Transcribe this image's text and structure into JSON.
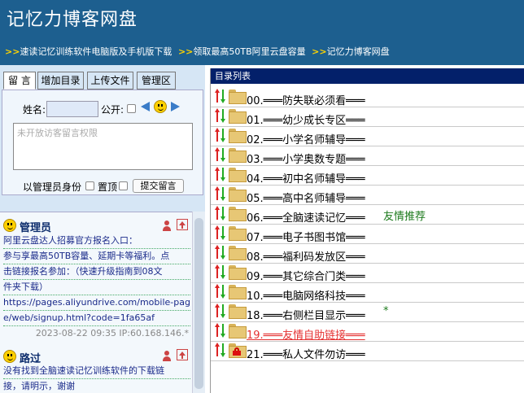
{
  "header": {
    "title": "记忆力博客网盘",
    "nav": [
      {
        "label": "速读记忆训练软件电脑版及手机版下载"
      },
      {
        "label": "领取最高50TB阿里云盘容量"
      },
      {
        "label": "记忆力博客网盘"
      }
    ]
  },
  "left": {
    "tabs": [
      "留 言",
      "增加目录",
      "上传文件",
      "管理区"
    ],
    "form": {
      "name_label": "姓名:",
      "public_label": "公开:",
      "textarea_placeholder": "未开放访客留言权限",
      "admin_label": "以管理员身份",
      "pin_label": "置顶",
      "submit_label": "提交留言"
    },
    "posts": [
      {
        "author": "管理员",
        "lines": [
          "阿里云盘达人招募官方报名入口：",
          "参与享最高50TB容量、延期卡等福利。点",
          "击链接报名参加：（快速升级指南到08文",
          "件夹下载）",
          "https://pages.aliyundrive.com/mobile-pag",
          "e/web/signup.html?code=1fa65af"
        ],
        "meta": "2023-08-22 09:35 IP:60.168.146.*"
      },
      {
        "author": "路过",
        "lines": [
          "没有找到全脑速读记忆训练软件的下载链",
          "接，请明示，谢谢"
        ],
        "meta": ""
      }
    ]
  },
  "right": {
    "header": "目录列表",
    "rows": [
      {
        "name": "00.═══防失联必须看═══",
        "extra": "",
        "special": false,
        "locked": false
      },
      {
        "name": "01.═══幼少成长专区═══",
        "extra": "",
        "special": false,
        "locked": false
      },
      {
        "name": "02.═══小学名师辅导═══",
        "extra": "",
        "special": false,
        "locked": false
      },
      {
        "name": "03.═══小学奥数专题═══",
        "extra": "",
        "special": false,
        "locked": false
      },
      {
        "name": "04.═══初中名师辅导═══",
        "extra": "",
        "special": false,
        "locked": false
      },
      {
        "name": "05.═══高中名师辅导═══",
        "extra": "",
        "special": false,
        "locked": false
      },
      {
        "name": "06.═══全脑速读记忆═══",
        "extra": "友情推荐",
        "special": false,
        "locked": false
      },
      {
        "name": "07.═══电子书图书馆═══",
        "extra": "",
        "special": false,
        "locked": false
      },
      {
        "name": "08.═══福利码发放区═══",
        "extra": "",
        "special": false,
        "locked": false
      },
      {
        "name": "09.═══其它综合门类═══",
        "extra": "",
        "special": false,
        "locked": false
      },
      {
        "name": "10.═══电脑网络科技═══",
        "extra": "",
        "special": false,
        "locked": false
      },
      {
        "name": "18.═══右侧栏目显示═══",
        "extra": "*",
        "special": false,
        "locked": false
      },
      {
        "name": "19.═══友情自助链接═══",
        "extra": "",
        "special": true,
        "locked": false
      },
      {
        "name": "21.═══私人文件勿访═══",
        "extra": "",
        "special": false,
        "locked": true
      }
    ]
  },
  "colors": {
    "header_bg": "#1d5f8f",
    "list_header_bg": "#03206a",
    "special_link": "#e53030",
    "recommend": "#1c7a1c"
  }
}
